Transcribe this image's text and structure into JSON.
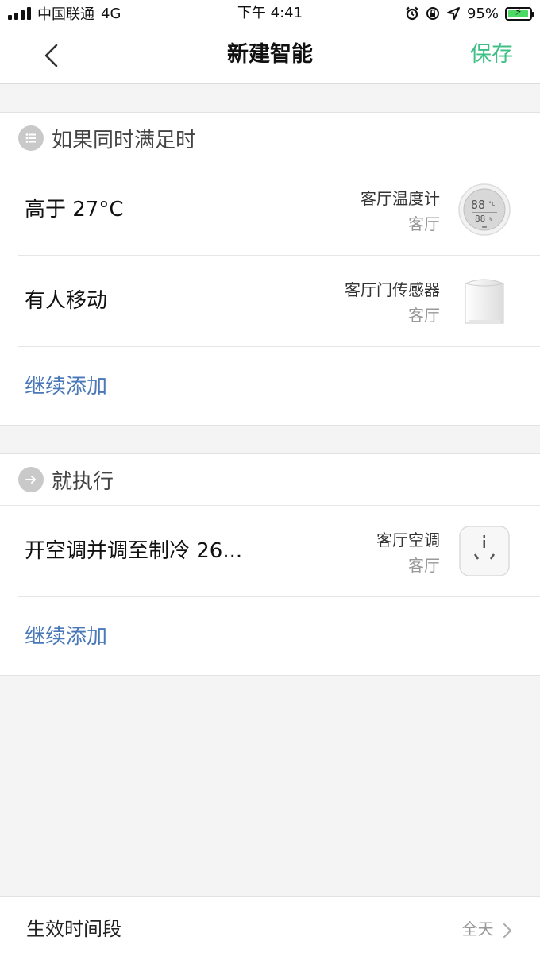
{
  "status_bar": {
    "carrier": "中国联通",
    "network": "4G",
    "time": "下午 4:41",
    "battery_percent": "95%",
    "battery_level": 0.95,
    "icons": [
      "alarm-icon",
      "orientation-lock-icon",
      "location-icon"
    ]
  },
  "nav": {
    "title": "新建智能",
    "save_label": "保存",
    "back_icon": "chevron-left-icon"
  },
  "conditions": {
    "header_title": "如果同时满足时",
    "header_icon": "list-icon",
    "items": [
      {
        "label": "高于 27°C",
        "device_name": "客厅温度计",
        "room": "客厅",
        "device_icon": "thermometer-icon"
      },
      {
        "label": "有人移动",
        "device_name": "客厅门传感器",
        "room": "客厅",
        "device_icon": "motion-sensor-icon"
      }
    ],
    "add_label": "继续添加"
  },
  "actions": {
    "header_title": "就执行",
    "header_icon": "arrow-right-icon",
    "items": [
      {
        "label": "开空调并调至制冷 26...",
        "device_name": "客厅空调",
        "room": "客厅",
        "device_icon": "ac-plug-icon"
      }
    ],
    "add_label": "继续添加"
  },
  "schedule": {
    "label": "生效时间段",
    "value": "全天"
  },
  "colors": {
    "accent_green": "#3fbf86",
    "link_blue": "#4a78b8",
    "background": "#f4f4f4"
  }
}
